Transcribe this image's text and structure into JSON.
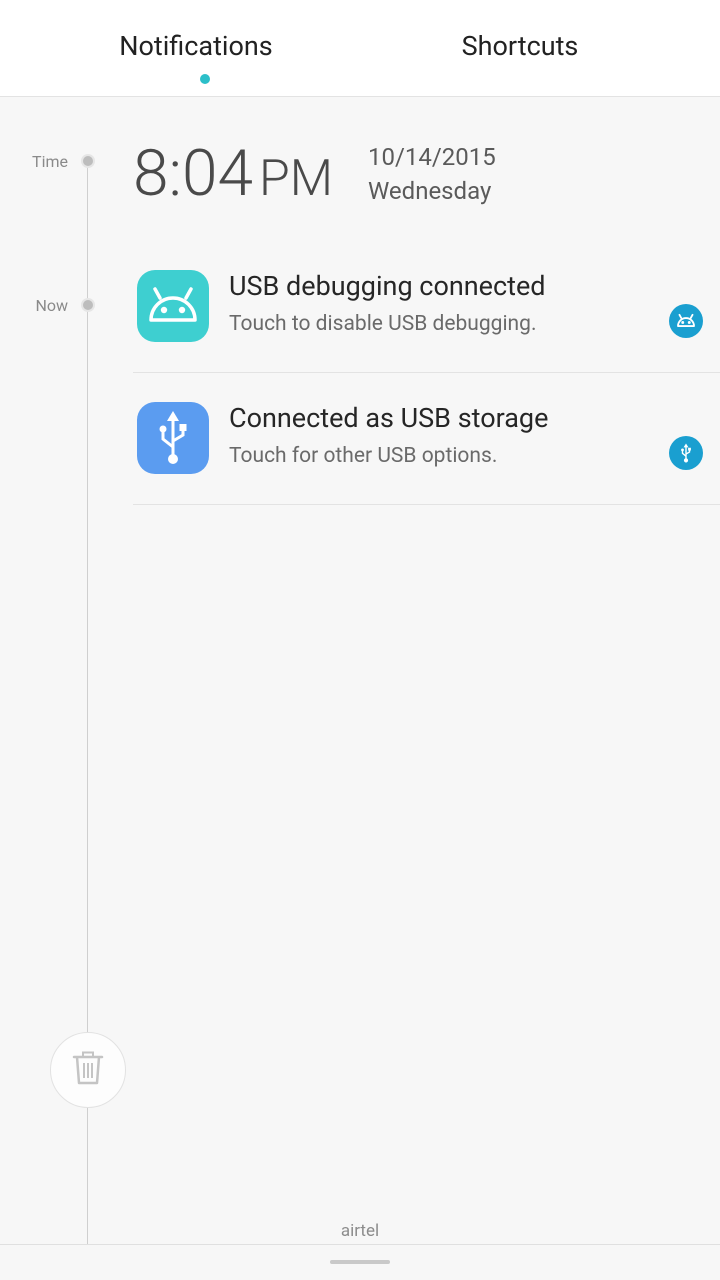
{
  "tabs": [
    {
      "label": "Notifications",
      "active": true
    },
    {
      "label": "Shortcuts",
      "active": false
    }
  ],
  "timeline": {
    "time_label": "Time",
    "now_label": "Now"
  },
  "clock": {
    "time": "8:04",
    "ampm": "PM",
    "date": "10/14/2015",
    "weekday": "Wednesday"
  },
  "notifications": [
    {
      "title": "USB debugging connected",
      "subtitle": "Touch to disable USB debugging.",
      "app_icon": "android-icon",
      "app_icon_color": "#3ecfd0",
      "badge_icon": "android-icon",
      "badge_color": "#1a9fd0"
    },
    {
      "title": "Connected as USB storage",
      "subtitle": "Touch for other USB options.",
      "app_icon": "usb-icon",
      "app_icon_color": "#5b9cf0",
      "badge_icon": "usb-icon",
      "badge_color": "#1a9fd0"
    }
  ],
  "footer": {
    "carrier": "airtel",
    "clear_icon": "trash-icon"
  },
  "colors": {
    "accent": "#2cbfc9"
  }
}
